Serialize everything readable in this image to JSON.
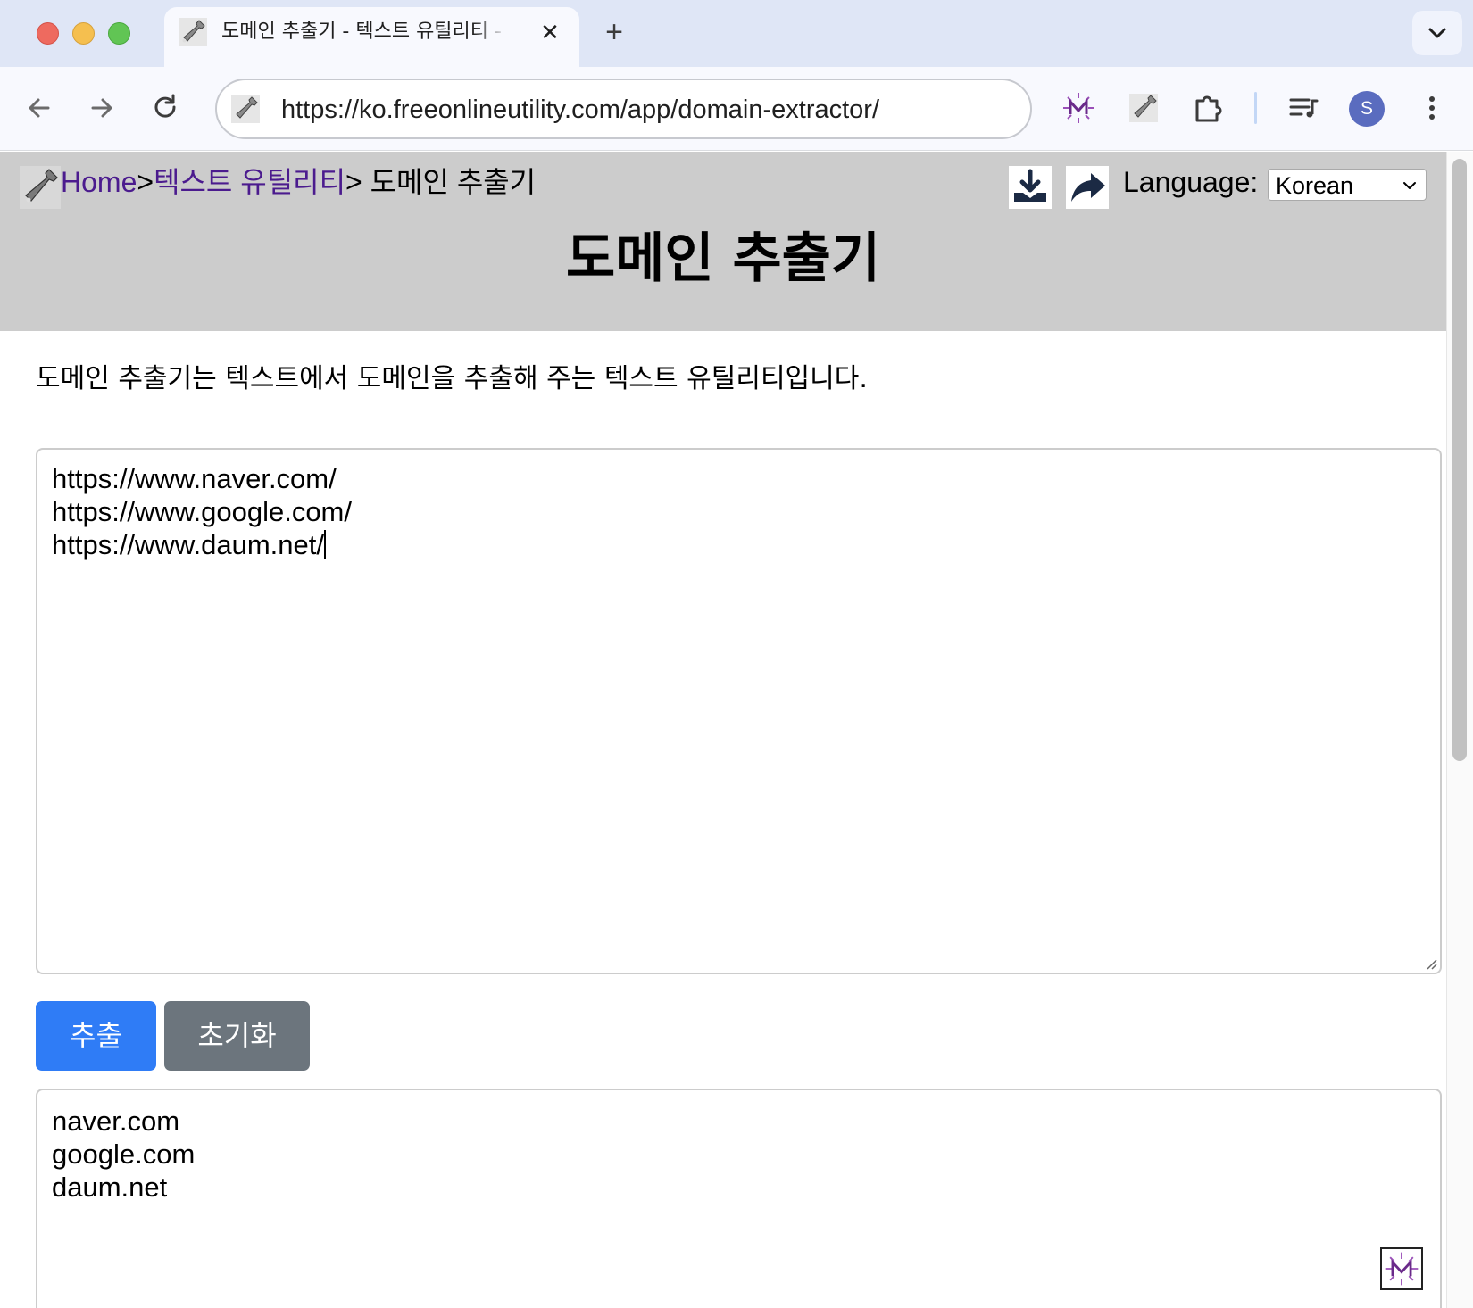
{
  "browser": {
    "tab": {
      "title": "도메인 추출기 - 텍스트 유틸리티 - Free Online Utility"
    },
    "new_tab_label": "+",
    "close_label": "✕",
    "address": "https://ko.freeonlineutility.com/app/domain-extractor/",
    "avatar_initial": "S",
    "colors": {
      "tabbar": "#dfe6f6",
      "toolbar": "#f8f9fe",
      "avatar": "#5a6cbf"
    }
  },
  "header": {
    "breadcrumb": {
      "home": "Home",
      "sep1": ">",
      "category": "텍스트 유틸리티",
      "sep2": "> ",
      "current": "도메인 추출기"
    },
    "language_label": "Language:",
    "language_value": "Korean",
    "title": "도메인 추출기"
  },
  "main": {
    "description": "도메인 추출기는 텍스트에서 도메인을 추출해 주는 텍스트 유틸리티입니다.",
    "input_lines": [
      "https://www.naver.com/",
      "https://www.google.com/",
      "https://www.daum.net/"
    ],
    "extract_label": "추출",
    "reset_label": "초기화",
    "output_lines": [
      "naver.com",
      "google.com",
      "daum.net"
    ],
    "colors": {
      "primary_button": "#2f7cf6",
      "secondary_button": "#6c757d",
      "header_band": "#cccccc",
      "link": "#4b1b8e"
    }
  },
  "icons": [
    "back-icon",
    "forward-icon",
    "reload-icon",
    "site-favicon",
    "extension-m-icon",
    "wrench-extension-icon",
    "puzzle-icon",
    "media-queue-icon",
    "more-icon",
    "download-icon",
    "share-icon",
    "chevron-down-icon"
  ]
}
